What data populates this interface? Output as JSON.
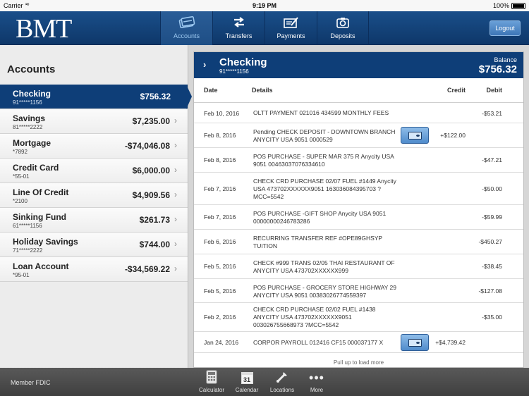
{
  "status_bar": {
    "carrier": "Carrier",
    "time": "9:19 PM",
    "battery": "100%"
  },
  "header": {
    "logo": "BMT",
    "tabs": [
      {
        "label": "Accounts",
        "icon": "accounts-icon"
      },
      {
        "label": "Transfers",
        "icon": "transfers-icon"
      },
      {
        "label": "Payments",
        "icon": "payments-icon"
      },
      {
        "label": "Deposits",
        "icon": "deposits-icon"
      }
    ],
    "logout": "Logout"
  },
  "sidebar": {
    "title": "Accounts",
    "accounts": [
      {
        "name": "Checking",
        "number": "91*****1156",
        "balance": "$756.32"
      },
      {
        "name": "Savings",
        "number": "81*****2222",
        "balance": "$7,235.00"
      },
      {
        "name": "Mortgage",
        "number": "*7892",
        "balance": "-$74,046.08"
      },
      {
        "name": "Credit Card",
        "number": "*55-01",
        "balance": "$6,000.00"
      },
      {
        "name": "Line Of Credit",
        "number": "*2100",
        "balance": "$4,909.56"
      },
      {
        "name": "Sinking Fund",
        "number": "61*****1156",
        "balance": "$261.73"
      },
      {
        "name": "Holiday Savings",
        "number": "71*****2222",
        "balance": "$744.00"
      },
      {
        "name": "Loan Account",
        "number": "*95-01",
        "balance": "-$34,569.22"
      }
    ]
  },
  "account_detail": {
    "name": "Checking",
    "number": "91*****1156",
    "balance_label": "Balance",
    "balance": "$756.32",
    "columns": {
      "date": "Date",
      "details": "Details",
      "credit": "Credit",
      "debit": "Debit"
    },
    "transactions": [
      {
        "date": "Feb 10, 2016",
        "details": "OLTT PAYMENT 021016 434599 MONTHLY FEES",
        "credit": "",
        "debit": "-$53.21"
      },
      {
        "date": "Feb 8, 2016",
        "details": "Pending CHECK DEPOSIT - DOWNTOWN BRANCH ANYCITY USA 9051 0000529",
        "credit": "+$122.00",
        "debit": ""
      },
      {
        "date": "Feb 8, 2016",
        "details": "POS PURCHASE - SUPER MAR 375 R Anycity USA 9051 00463037076334610",
        "credit": "",
        "debit": "-$47.21"
      },
      {
        "date": "Feb 7, 2016",
        "details": "CHECK CRD PURCHASE 02/07 FUEL #1449 Anycity USA 473702XXXXXX9051 163036084395703 ?MCC=5542",
        "credit": "",
        "debit": "-$50.00"
      },
      {
        "date": "Feb 7, 2016",
        "details": "POS PURCHASE -GIFT SHOP Anycity USA 9051 00000000246783286",
        "credit": "",
        "debit": "-$59.99"
      },
      {
        "date": "Feb 6, 2016",
        "details": "RECURRING TRANSFER REF #OPE89GHSYP TUITION",
        "credit": "",
        "debit": "-$450.27"
      },
      {
        "date": "Feb 5, 2016",
        "details": "CHECK #999 TRANS 02/05 THAI RESTAURANT OF ANYCITY USA 473702XXXXXX999",
        "credit": "",
        "debit": "-$38.45"
      },
      {
        "date": "Feb 5, 2016",
        "details": "POS PURCHASE - GROCERY STORE HIGHWAY 29 ANYCITY USA 9051 00383026774559397",
        "credit": "",
        "debit": "-$127.08"
      },
      {
        "date": "Feb 2, 2016",
        "details": "CHECK CRD PURCHASE 02/02 FUEL #1438 ANYCITY USA 473702XXXXXX9051 003026755668973 ?MCC=5542",
        "credit": "",
        "debit": "-$35.00"
      },
      {
        "date": "Jan 24, 2016",
        "details": "CORPOR PAYROLL 012416 CF15 000037177 X",
        "credit": "+$4,739.42",
        "debit": ""
      }
    ],
    "pull_more": "Pull up to load more"
  },
  "footer": {
    "fdic": "Member FDIC",
    "tools": [
      {
        "label": "Calculator",
        "icon": "calculator-icon"
      },
      {
        "label": "Calendar",
        "icon": "calendar-icon",
        "calendar_day": "31"
      },
      {
        "label": "Locations",
        "icon": "locations-icon"
      },
      {
        "label": "More",
        "icon": "more-icon"
      }
    ]
  }
}
